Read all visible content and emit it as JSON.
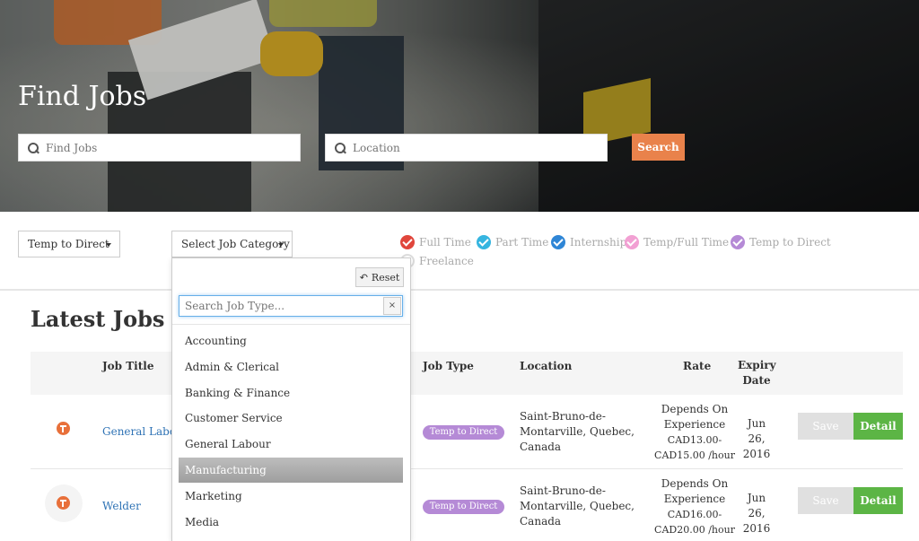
{
  "hero": {
    "title": "Find Jobs",
    "keyword_placeholder": "Find Jobs",
    "location_placeholder": "Location",
    "search_label": "Search"
  },
  "filters": {
    "job_type_selected": "Temp to Direct",
    "category_selected": "Select Job Category",
    "types": [
      {
        "label": "Full Time",
        "color": "#e0463c",
        "checked": true
      },
      {
        "label": "Part Time",
        "color": "#36b5e0",
        "checked": true
      },
      {
        "label": "Internship",
        "color": "#2f86d6",
        "checked": true
      },
      {
        "label": "Temp/Full Time",
        "color": "#f2a0d3",
        "checked": true
      },
      {
        "label": "Temp to Direct",
        "color": "#b58ad6",
        "checked": true
      },
      {
        "label": "Freelance",
        "color": "#dddddd",
        "checked": false
      }
    ]
  },
  "category_dropdown": {
    "reset_label": "Reset",
    "search_placeholder": "Search Job Type...",
    "clear_label": "×",
    "options": [
      "Accounting",
      "Admin & Clerical",
      "Banking & Finance",
      "Customer Service",
      "General Labour",
      "Manufacturing",
      "Marketing",
      "Media"
    ],
    "highlighted": "Manufacturing"
  },
  "jobs": {
    "section_title": "Latest Jobs",
    "columns": {
      "title": "Job Title",
      "type": "Job Type",
      "location": "Location",
      "rate": "Rate",
      "expiry_1": "Expiry",
      "expiry_2": "Date"
    },
    "rows": [
      {
        "title": "General Labor",
        "type": "Temp to Direct",
        "location": [
          "Saint-Bruno-de-",
          "Montarville, Quebec,",
          "Canada"
        ],
        "rate": [
          "Depends On",
          "Experience",
          "CAD13.00-",
          "CAD15.00 /hour"
        ],
        "expiry": [
          "Jun 26,",
          "2016"
        ],
        "save_label": "Save",
        "detail_label": "Detail"
      },
      {
        "title": "Welder",
        "type": "Temp to Direct",
        "location": [
          "Saint-Bruno-de-",
          "Montarville, Quebec,",
          "Canada"
        ],
        "rate": [
          "Depends On",
          "Experience",
          "CAD16.00-",
          "CAD20.00 /hour"
        ],
        "expiry": [
          "Jun 26,",
          "2016"
        ],
        "save_label": "Save",
        "detail_label": "Detail"
      }
    ]
  }
}
